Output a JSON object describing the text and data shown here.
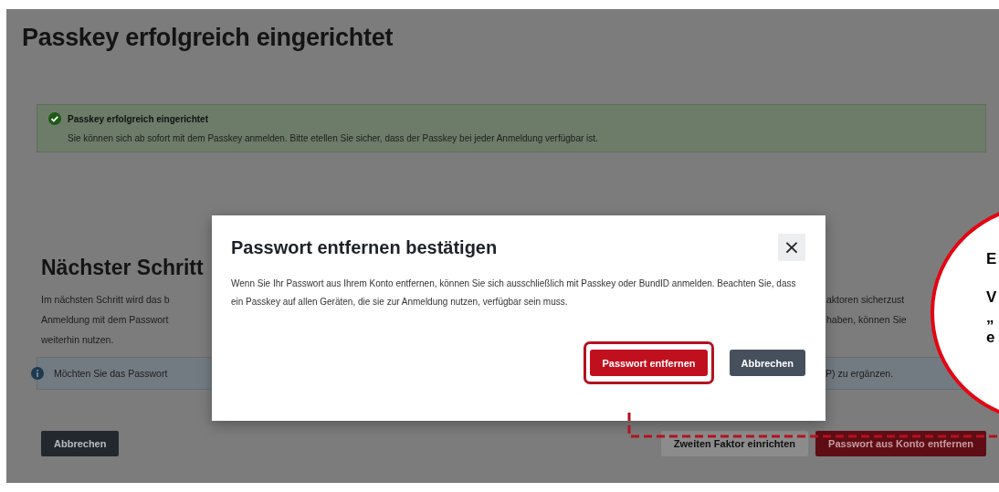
{
  "page": {
    "title": "Passkey erfolgreich eingerichtet",
    "success_alert": {
      "title": "Passkey erfolgreich eingerichtet",
      "text": "Sie können sich ab sofort mit dem Passkey anmelden. Bitte etellen Sie sicher, dass der Passkey bei jeder Anmeldung verfügbar ist."
    },
    "next_step": {
      "heading": "Nächster Schritt",
      "paragraph_lines": [
        {
          "left": "Im nächsten Schritt wird das b",
          "right": "aktoren sicherzust"
        },
        {
          "left": "Anmeldung mit dem Passwort",
          "right": "haben, können Sie"
        },
        {
          "left": "weiterhin nutzen."
        }
      ],
      "info_alert": {
        "left": "Möchten Sie das Passwort",
        "right": "P) zu ergänzen."
      }
    },
    "buttons": [
      {
        "label": "Abbrechen",
        "kind": "dark"
      },
      {
        "label": "Zweiten Faktor einrichten",
        "kind": "light"
      },
      {
        "label": "Passwort aus Konto entfernen",
        "kind": "danger"
      }
    ]
  },
  "dialog": {
    "title": "Passwort entfernen bestätigen",
    "close": "×",
    "text": "Wenn Sie Ihr Passwort aus Ihrem Konto entfernen, können Sie sich ausschließlich mit Passkey oder BundID anmelden. Beachten Sie, dass ein Passkey auf allen Geräten, die sie zur Anmeldung nutzen, verfügbar sein muss.",
    "buttons": [
      {
        "label": "Passwort entfernen",
        "kind": "danger",
        "highlighted": true
      },
      {
        "label": "Abbrechen",
        "kind": "dark",
        "highlighted": false
      }
    ]
  },
  "callout": {
    "lines": [
      "E",
      "V",
      "„",
      "e"
    ]
  }
}
